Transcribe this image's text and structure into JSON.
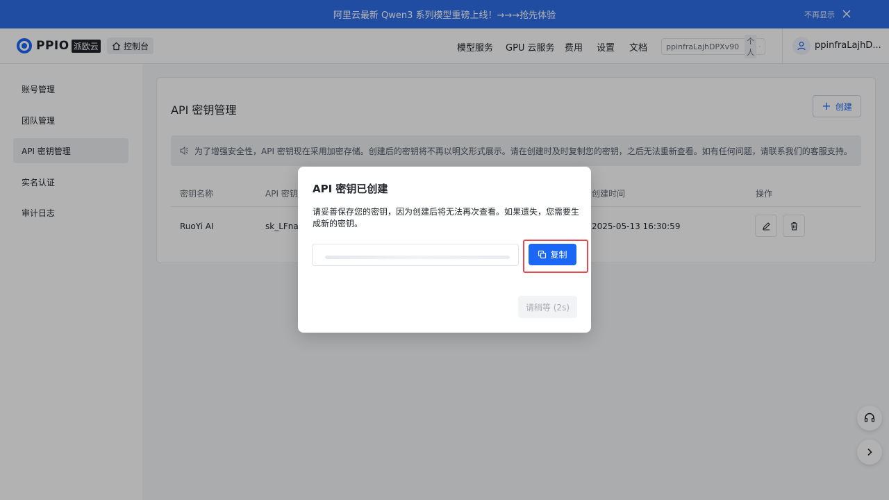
{
  "banner": {
    "message": "阿里云最新 Qwen3 系列模型重磅上线！→→→抢先体验",
    "dismiss_label": "不再显示"
  },
  "header": {
    "brand": "PPIO",
    "brand_cn": "派欧云",
    "console_label": "控制台",
    "nav": [
      "模型服务",
      "GPU 云服务",
      "费用",
      "设置",
      "文档"
    ],
    "account_id": "ppinfraLajhDPXv90",
    "account_type": "个人",
    "username": "ppinfraLajhD..."
  },
  "sidebar": {
    "items": [
      {
        "label": "账号管理",
        "active": false
      },
      {
        "label": "团队管理",
        "active": false
      },
      {
        "label": "API 密钥管理",
        "active": true
      },
      {
        "label": "实名认证",
        "active": false
      },
      {
        "label": "审计日志",
        "active": false
      }
    ]
  },
  "main": {
    "title": "API 密钥管理",
    "create_label": "创建",
    "notice": "为了增强安全性，API 密钥现在采用加密存储。创建后的密钥将不再以明文形式展示。请在创建时及时复制您的密钥，之后无法重新查看。如有任何问题，请联系我们的客服支持。",
    "table": {
      "headers": {
        "name": "密钥名称",
        "key": "API 密钥",
        "created": "创建时间",
        "actions": "操作"
      },
      "rows": [
        {
          "name": "RuoYi AI",
          "key": "sk_LFna*",
          "created": "2025-05-13 16:30:59"
        }
      ]
    }
  },
  "modal": {
    "title": "API 密钥已创建",
    "description": "请妥善保存您的密钥，因为创建后将无法再次查看。如果遗失，您需要生成新的密钥。",
    "copy_label": "复制",
    "wait_label": "请稍等 (2s)"
  },
  "colors": {
    "accent": "#1a66f5",
    "banner": "#2f6fe8",
    "highlight": "#e5484d"
  },
  "icons": [
    "close-icon",
    "home-icon",
    "swap-icon",
    "user-icon",
    "speaker-icon",
    "edit-icon",
    "trash-icon",
    "copy-icon",
    "headset-icon",
    "chevron-right-icon"
  ]
}
